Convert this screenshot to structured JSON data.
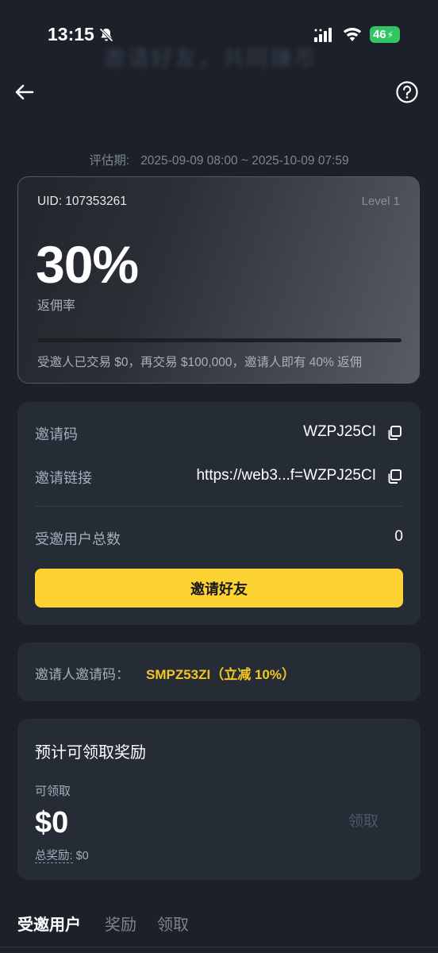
{
  "status_bar": {
    "time": "13:15",
    "battery": "46",
    "icons": [
      "bell-off-icon",
      "signal-icon",
      "wifi-icon",
      "battery-charging-icon"
    ]
  },
  "header": {
    "blurred_title": "邀请好友，共同赚币",
    "back_icon": "arrow-left-icon",
    "help_icon": "question-circle-icon"
  },
  "period": {
    "label": "评估期:",
    "range": "2025-09-09 08:00 ~ 2025-10-09 07:59"
  },
  "level_card": {
    "uid": "UID: 107353261",
    "level": "Level 1",
    "rate_value": "30%",
    "rate_label": "返佣率",
    "progress_fraction": 0,
    "progress_note": "受邀人已交易 $0，再交易 $100,000，邀请人即有 40% 返佣"
  },
  "invite_card": {
    "code_label": "邀请码",
    "code_value": "WZPJ25CI",
    "link_label": "邀请链接",
    "link_value": "https://web3...f=WZPJ25CI",
    "total_label": "受邀用户总数",
    "total_value": "0",
    "invite_button": "邀请好友",
    "copy_icon": "copy-icon"
  },
  "inviter_card": {
    "label": "邀请人邀请码：",
    "code": "SMPZ53ZI（立减 10%）"
  },
  "reward_card": {
    "title": "预计可领取奖励",
    "claimable_label": "可领取",
    "claimable_value": "$0",
    "total_label": "总奖励:",
    "total_value": "$0",
    "claim_button": "领取"
  },
  "tabs": [
    {
      "label": "受邀用户",
      "active": true
    },
    {
      "label": "奖励",
      "active": false
    },
    {
      "label": "领取",
      "active": false
    }
  ],
  "colors": {
    "background": "#1b2029",
    "card": "#262c36",
    "accent_yellow": "#fdd333",
    "inviter_code": "#f3c622",
    "battery_green": "#33c463"
  }
}
